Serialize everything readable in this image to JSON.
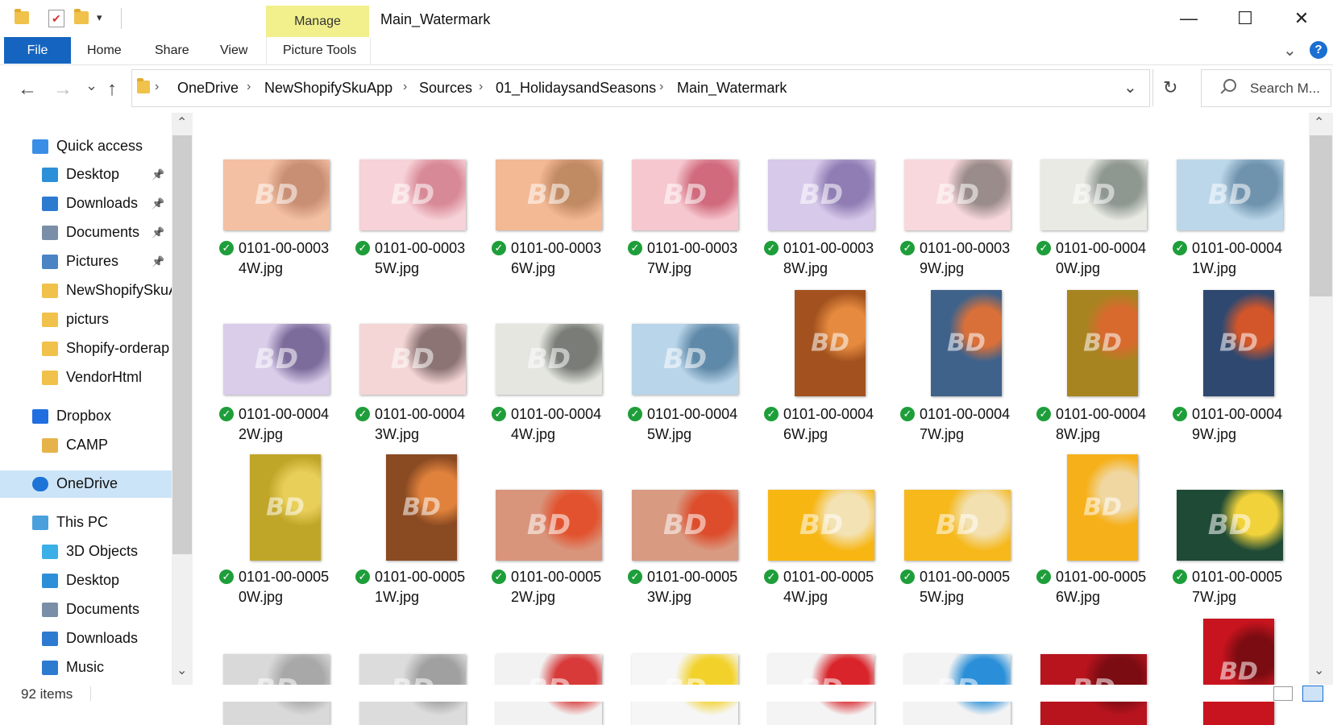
{
  "window": {
    "title": "Main_Watermark",
    "minimize_glyph": "—",
    "maximize_glyph": "☐",
    "close_glyph": "✕"
  },
  "ribbon": {
    "manage_label": "Manage",
    "tabs": {
      "file": "File",
      "home": "Home",
      "share": "Share",
      "view": "View",
      "picture_tools": "Picture Tools"
    },
    "help_glyph": "?",
    "expand_glyph": "⌄"
  },
  "address": {
    "back_glyph": "←",
    "forward_glyph": "→",
    "recent_glyph": "⌄",
    "up_glyph": "↑",
    "breadcrumbs": [
      "OneDrive",
      "NewShopifySkuApp",
      "Sources",
      "01_HolidaysandSeasons",
      "Main_Watermark"
    ],
    "separator": "›",
    "dropdown_glyph": "⌄",
    "refresh_glyph": "↻",
    "search_placeholder": "Search M..."
  },
  "nav": {
    "items": [
      {
        "label": "Quick access",
        "icon": "star-icon",
        "color": "#3a8ee6"
      },
      {
        "label": "Desktop",
        "icon": "desktop-icon",
        "color": "#2d8fd8",
        "pinned": true
      },
      {
        "label": "Downloads",
        "icon": "download-icon",
        "color": "#2d7bd1",
        "pinned": true
      },
      {
        "label": "Documents",
        "icon": "document-icon",
        "color": "#7a8ea8",
        "pinned": true
      },
      {
        "label": "Pictures",
        "icon": "pictures-icon",
        "color": "#4a84c4",
        "pinned": true
      },
      {
        "label": "NewShopifySkuA",
        "icon": "folder-icon",
        "color": "#f0c24b"
      },
      {
        "label": "picturs",
        "icon": "folder-icon",
        "color": "#f0c24b"
      },
      {
        "label": "Shopify-orderap",
        "icon": "folder-icon",
        "color": "#f0c24b"
      },
      {
        "label": "VendorHtml",
        "icon": "folder-icon",
        "color": "#f0c24b"
      },
      {
        "label": "Dropbox",
        "icon": "dropbox-icon",
        "color": "#1f6fe0"
      },
      {
        "label": "CAMP",
        "icon": "folder-icon",
        "color": "#e6b34a"
      },
      {
        "label": "OneDrive",
        "icon": "cloud-icon",
        "color": "#1d73d6",
        "selected": true
      },
      {
        "label": "This PC",
        "icon": "pc-icon",
        "color": "#4aa0dd"
      },
      {
        "label": "3D Objects",
        "icon": "cube-icon",
        "color": "#3ab0e6"
      },
      {
        "label": "Desktop",
        "icon": "desktop-icon",
        "color": "#2d8fd8"
      },
      {
        "label": "Documents",
        "icon": "document-icon",
        "color": "#7a8ea8"
      },
      {
        "label": "Downloads",
        "icon": "download-icon",
        "color": "#2d7bd1"
      },
      {
        "label": "Music",
        "icon": "music-icon",
        "color": "#2d7bd1"
      }
    ],
    "pin_glyph": "📌"
  },
  "files": [
    {
      "line1": "0101-00-0003",
      "line2": "4W.jpg",
      "bg": "#f3c0a3",
      "accent": "#c98f74",
      "orient": "land"
    },
    {
      "line1": "0101-00-0003",
      "line2": "5W.jpg",
      "bg": "#f7d2d8",
      "accent": "#d88997",
      "orient": "land"
    },
    {
      "line1": "0101-00-0003",
      "line2": "6W.jpg",
      "bg": "#f3b894",
      "accent": "#c08a63",
      "orient": "land"
    },
    {
      "line1": "0101-00-0003",
      "line2": "7W.jpg",
      "bg": "#f6c7cf",
      "accent": "#d06a7c",
      "orient": "land"
    },
    {
      "line1": "0101-00-0003",
      "line2": "8W.jpg",
      "bg": "#d7c9ea",
      "accent": "#8f7db4",
      "orient": "land"
    },
    {
      "line1": "0101-00-0003",
      "line2": "9W.jpg",
      "bg": "#f8d8dc",
      "accent": "#9a8c8a",
      "orient": "land"
    },
    {
      "line1": "0101-00-0004",
      "line2": "0W.jpg",
      "bg": "#e8eae3",
      "accent": "#8f9791",
      "orient": "land"
    },
    {
      "line1": "0101-00-0004",
      "line2": "1W.jpg",
      "bg": "#bcd7ea",
      "accent": "#6f93ad",
      "orient": "land"
    },
    {
      "line1": "0101-00-0004",
      "line2": "2W.jpg",
      "bg": "#dacdea",
      "accent": "#7c6c9c",
      "orient": "land"
    },
    {
      "line1": "0101-00-0004",
      "line2": "3W.jpg",
      "bg": "#f5d6d6",
      "accent": "#8c7474",
      "orient": "land"
    },
    {
      "line1": "0101-00-0004",
      "line2": "4W.jpg",
      "bg": "#e4e6df",
      "accent": "#7a7d77",
      "orient": "land"
    },
    {
      "line1": "0101-00-0004",
      "line2": "5W.jpg",
      "bg": "#b9d5ea",
      "accent": "#5f89a8",
      "orient": "land"
    },
    {
      "line1": "0101-00-0004",
      "line2": "6W.jpg",
      "bg": "#a3521f",
      "accent": "#e58a3e",
      "orient": "port"
    },
    {
      "line1": "0101-00-0004",
      "line2": "7W.jpg",
      "bg": "#3f628b",
      "accent": "#d9703a",
      "orient": "port"
    },
    {
      "line1": "0101-00-0004",
      "line2": "8W.jpg",
      "bg": "#a88420",
      "accent": "#d86a2e",
      "orient": "port"
    },
    {
      "line1": "0101-00-0004",
      "line2": "9W.jpg",
      "bg": "#2e4870",
      "accent": "#d2562a",
      "orient": "port"
    },
    {
      "line1": "0101-00-0005",
      "line2": "0W.jpg",
      "bg": "#c0a628",
      "accent": "#e8cf5a",
      "orient": "port"
    },
    {
      "line1": "0101-00-0005",
      "line2": "1W.jpg",
      "bg": "#8a4a22",
      "accent": "#e0823c",
      "orient": "port"
    },
    {
      "line1": "0101-00-0005",
      "line2": "2W.jpg",
      "bg": "#d9957c",
      "accent": "#e2522e",
      "orient": "land"
    },
    {
      "line1": "0101-00-0005",
      "line2": "3W.jpg",
      "bg": "#d99a82",
      "accent": "#dd4d2c",
      "orient": "land"
    },
    {
      "line1": "0101-00-0005",
      "line2": "4W.jpg",
      "bg": "#f7b612",
      "accent": "#f3e2b4",
      "orient": "land"
    },
    {
      "line1": "0101-00-0005",
      "line2": "5W.jpg",
      "bg": "#f6b81a",
      "accent": "#f2e0b0",
      "orient": "land"
    },
    {
      "line1": "0101-00-0005",
      "line2": "6W.jpg",
      "bg": "#f6b01a",
      "accent": "#f0d7a2",
      "orient": "port"
    },
    {
      "line1": "0101-00-0005",
      "line2": "7W.jpg",
      "bg": "#1f4a36",
      "accent": "#f1d23b",
      "orient": "land"
    },
    {
      "line1": "",
      "line2": "",
      "bg": "#d9d9d9",
      "accent": "#a8a8a8",
      "orient": "land"
    },
    {
      "line1": "",
      "line2": "",
      "bg": "#dcdcdc",
      "accent": "#a0a0a0",
      "orient": "land"
    },
    {
      "line1": "",
      "line2": "",
      "bg": "#f2f2f2",
      "accent": "#d83a3a",
      "orient": "land"
    },
    {
      "line1": "",
      "line2": "",
      "bg": "#f6f6f6",
      "accent": "#f2d22a",
      "orient": "land"
    },
    {
      "line1": "",
      "line2": "",
      "bg": "#f4f4f4",
      "accent": "#d8242a",
      "orient": "land"
    },
    {
      "line1": "",
      "line2": "",
      "bg": "#f3f3f3",
      "accent": "#2a8fd8",
      "orient": "land"
    },
    {
      "line1": "",
      "line2": "",
      "bg": "#b8141e",
      "accent": "#7a0c12",
      "orient": "land"
    },
    {
      "line1": "",
      "line2": "",
      "bg": "#c8141e",
      "accent": "#7a0c12",
      "orient": "port"
    }
  ],
  "watermark_text": "BD",
  "check_glyph": "✓",
  "status": {
    "items_text": "92 items"
  },
  "scroll": {
    "up_glyph": "⌃",
    "down_glyph": "⌄"
  }
}
